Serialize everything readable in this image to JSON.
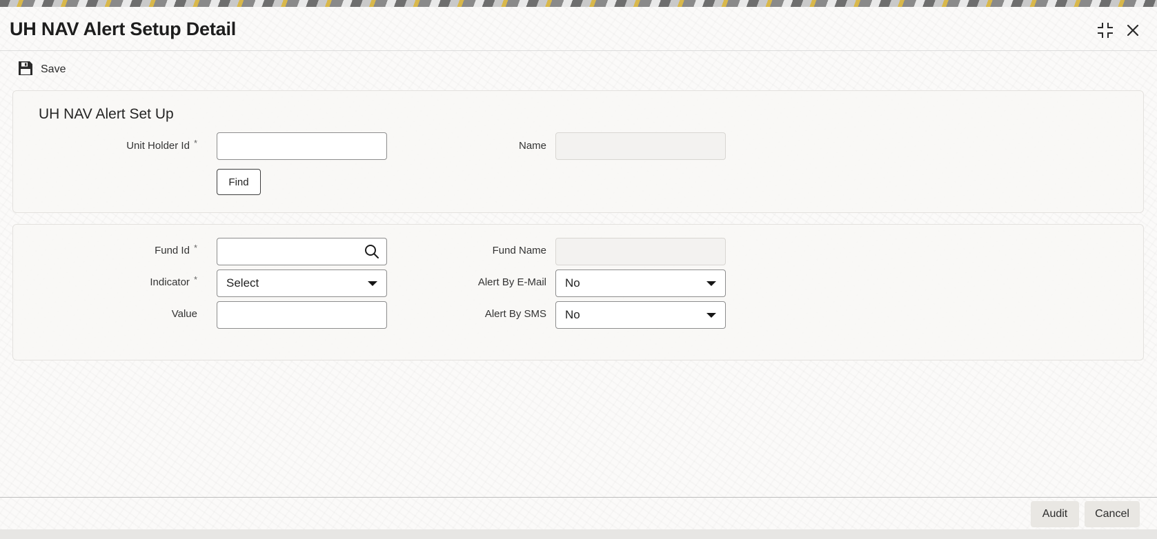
{
  "window": {
    "title": "UH NAV Alert Setup Detail",
    "icons": {
      "maximize": "maximize-icon",
      "close": "close-icon"
    }
  },
  "toolbar": {
    "save_label": "Save",
    "save_icon": "floppy-disk-icon"
  },
  "section1": {
    "title": "UH NAV Alert Set Up",
    "unit_holder_id_label": "Unit Holder Id",
    "unit_holder_id_value": "",
    "required_mark": "*",
    "name_label": "Name",
    "name_value": "",
    "find_label": "Find"
  },
  "section2": {
    "fund_id_label": "Fund Id",
    "fund_id_value": "",
    "fund_name_label": "Fund Name",
    "fund_name_value": "",
    "indicator_label": "Indicator",
    "indicator_value": "Select",
    "alert_email_label": "Alert By E-Mail",
    "alert_email_value": "No",
    "value_label": "Value",
    "value_value": "",
    "alert_sms_label": "Alert By SMS",
    "alert_sms_value": "No",
    "search_icon": "search-icon"
  },
  "footer": {
    "audit_label": "Audit",
    "cancel_label": "Cancel"
  },
  "colors": {
    "panel_bg": "#f8f7f5",
    "border": "#8c8c8c",
    "footer_button": "#e9e7e3"
  }
}
